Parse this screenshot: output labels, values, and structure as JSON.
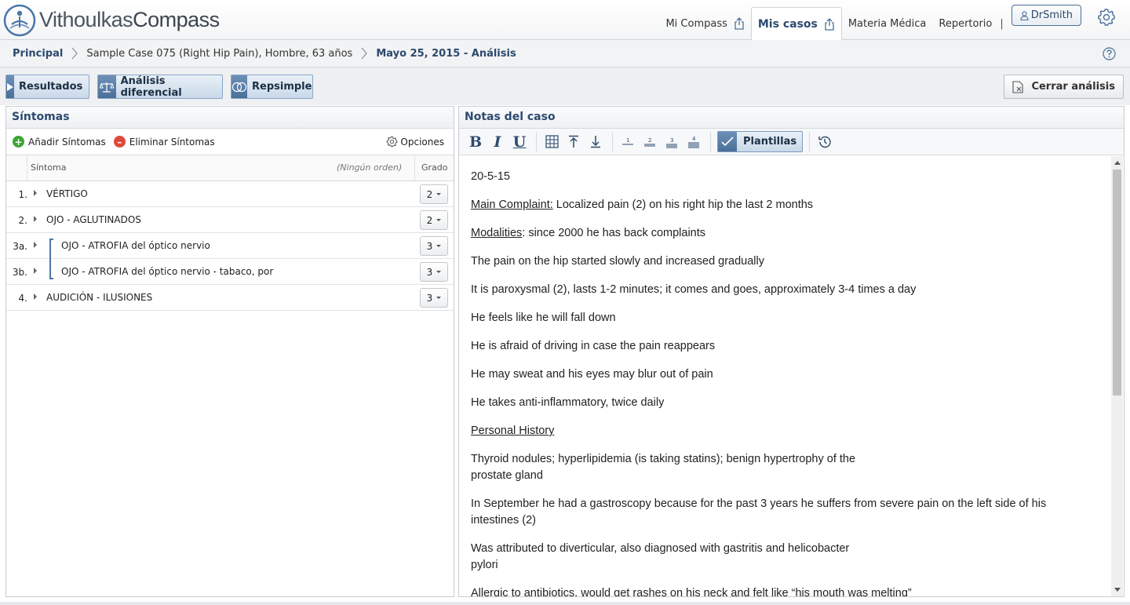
{
  "app": {
    "logo_part1": "Vithoulkas",
    "logo_part2": "Compass"
  },
  "nav": {
    "items": [
      {
        "label": "Mi Compass"
      },
      {
        "label": "Mis casos"
      },
      {
        "label": "Materia Médica"
      },
      {
        "label": "Repertorio"
      }
    ],
    "separator": "|",
    "user": "DrSmith"
  },
  "breadcrumb": {
    "home": "Principal",
    "case": "Sample Case 075 (Right Hip Pain), Hombre, 63 años",
    "current": "Mayo 25, 2015 - Análisis"
  },
  "toolbar": {
    "resultados": "Resultados",
    "analisis_diferencial": "Análisis diferencial",
    "repsimple": "Repsimple",
    "cerrar": "Cerrar análisis"
  },
  "symptoms_panel": {
    "title": "Síntomas",
    "add": "Añadir Síntomas",
    "remove": "Eliminar Síntomas",
    "options": "Opciones",
    "columns": {
      "symptom": "Síntoma",
      "order": "(Ningún orden)",
      "grade": "Grado"
    },
    "rows": [
      {
        "num": "1.",
        "text": "VÉRTIGO",
        "grade": "2"
      },
      {
        "num": "2.",
        "text": "OJO - AGLUTINADOS",
        "grade": "2"
      },
      {
        "num": "3a.",
        "text": "OJO - ATROFIA del óptico nervio",
        "grade": "3"
      },
      {
        "num": "3b.",
        "text": "OJO - ATROFIA del óptico nervio - tabaco, por",
        "grade": "3"
      },
      {
        "num": "4.",
        "text": "AUDICIÓN - ILUSIONES",
        "grade": "3"
      }
    ]
  },
  "notes_panel": {
    "title": "Notas del caso",
    "format": {
      "bold": "B",
      "italic": "I",
      "underline": "U"
    },
    "plantillas": "Plantillas",
    "notes": {
      "date": "20-5-15",
      "main_label": "Main Complaint:",
      "main_text": " Localized pain (2) on his right hip the last 2 months",
      "mod_label": "Modalities",
      "mod_text": ": since 2000 he has back complaints",
      "l1": "The pain on the hip started slowly and increased gradually",
      "l2": "It is paroxysmal (2), lasts 1-2 minutes; it comes and goes, approximately 3-4 times a day",
      "l3": "He feels like he will fall down",
      "l4": "He is afraid of driving in case the pain reappears",
      "l5": "He may sweat and his eyes may blur out of pain",
      "l6": "He takes anti-inflammatory, twice daily",
      "history_label": "Personal History",
      "h1a": "Thyroid nodules; hyperlipidemia (is taking statins); benign hypertrophy of the",
      "h1b": "prostate gland",
      "h2a": "In September he had a gastroscopy because for the past 3 years he suffers from severe pain on the left side of his",
      "h2b": "intestines (2)",
      "h3a": "Was attributed to diverticular, also diagnosed with gastritis and helicobacter",
      "h3b": "pylori",
      "h4": "Allergic to antibiotics, would get rashes on his neck and felt like “his mouth was melting”"
    }
  }
}
